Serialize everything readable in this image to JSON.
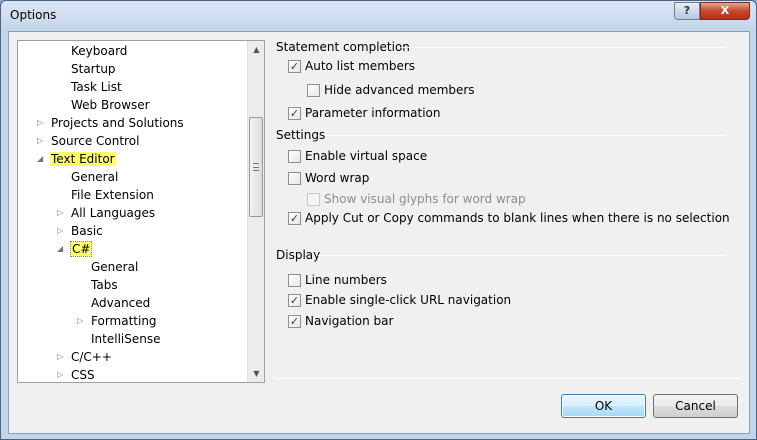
{
  "window": {
    "title": "Options",
    "help_glyph": "?",
    "close_glyph": "X"
  },
  "tree": {
    "items": [
      {
        "label": "Keyboard",
        "indent": 1,
        "arrow": "",
        "hl": ""
      },
      {
        "label": "Startup",
        "indent": 1,
        "arrow": "",
        "hl": ""
      },
      {
        "label": "Task List",
        "indent": 1,
        "arrow": "",
        "hl": ""
      },
      {
        "label": "Web Browser",
        "indent": 1,
        "arrow": "",
        "hl": ""
      },
      {
        "label": "Projects and Solutions",
        "indent": 0,
        "arrow": "▷",
        "hl": ""
      },
      {
        "label": "Source Control",
        "indent": 0,
        "arrow": "▷",
        "hl": ""
      },
      {
        "label": "Text Editor",
        "indent": 0,
        "arrow": "◢",
        "hl": "fill"
      },
      {
        "label": "General",
        "indent": 1,
        "arrow": "",
        "hl": ""
      },
      {
        "label": "File Extension",
        "indent": 1,
        "arrow": "",
        "hl": ""
      },
      {
        "label": "All Languages",
        "indent": 1,
        "arrow": "▷",
        "hl": ""
      },
      {
        "label": "Basic",
        "indent": 1,
        "arrow": "▷",
        "hl": ""
      },
      {
        "label": "C#",
        "indent": 1,
        "arrow": "◢",
        "hl": "box"
      },
      {
        "label": "General",
        "indent": 2,
        "arrow": "",
        "hl": ""
      },
      {
        "label": "Tabs",
        "indent": 2,
        "arrow": "",
        "hl": ""
      },
      {
        "label": "Advanced",
        "indent": 2,
        "arrow": "",
        "hl": ""
      },
      {
        "label": "Formatting",
        "indent": 2,
        "arrow": "▷",
        "hl": ""
      },
      {
        "label": "IntelliSense",
        "indent": 2,
        "arrow": "",
        "hl": ""
      },
      {
        "label": "C/C++",
        "indent": 1,
        "arrow": "▷",
        "hl": ""
      },
      {
        "label": "CSS",
        "indent": 1,
        "arrow": "▷",
        "hl": ""
      }
    ],
    "scroll_up_glyph": "▲",
    "scroll_down_glyph": "▼"
  },
  "statement_completion": {
    "header": "Statement completion",
    "auto_list_members": {
      "label": "Auto list members",
      "checked": true,
      "mark": "✓"
    },
    "hide_advanced_members": {
      "label": "Hide advanced members",
      "checked": false,
      "mark": ""
    },
    "parameter_information": {
      "label": "Parameter information",
      "checked": true,
      "mark": "✓"
    }
  },
  "settings": {
    "header": "Settings",
    "enable_virtual_space": {
      "label": "Enable virtual space",
      "checked": false,
      "mark": ""
    },
    "word_wrap": {
      "label": "Word wrap",
      "checked": false,
      "mark": ""
    },
    "show_visual_glyphs": {
      "label": "Show visual glyphs for word wrap",
      "checked": false,
      "mark": ""
    },
    "apply_cut_copy": {
      "label": "Apply Cut or Copy commands to blank lines when there is no selection",
      "checked": true,
      "mark": "✓"
    }
  },
  "display": {
    "header": "Display",
    "line_numbers": {
      "label": "Line numbers",
      "checked": false,
      "mark": ""
    },
    "single_click_url": {
      "label": "Enable single-click URL navigation",
      "checked": true,
      "mark": "✓"
    },
    "navigation_bar": {
      "label": "Navigation bar",
      "checked": true,
      "mark": "✓"
    }
  },
  "buttons": {
    "ok": "OK",
    "cancel": "Cancel"
  }
}
